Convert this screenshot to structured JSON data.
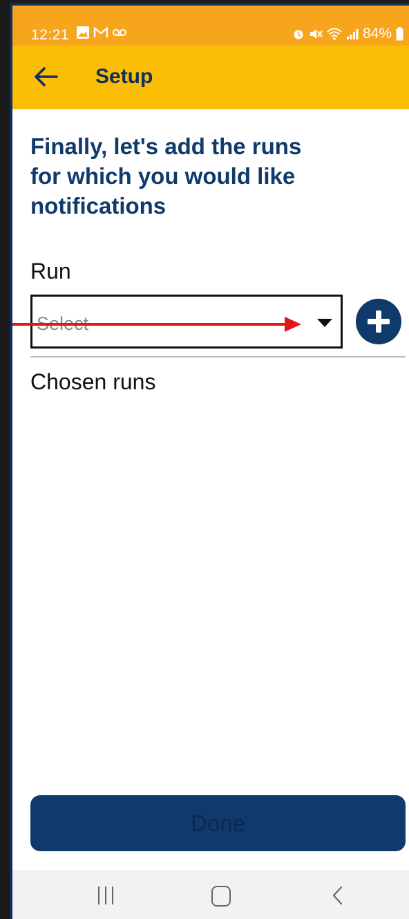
{
  "status_bar": {
    "time": "12:21",
    "battery": "84%",
    "left_icons": [
      "gallery-icon",
      "gmail-icon",
      "voicemail-icon"
    ],
    "right_icons": [
      "alarm-icon",
      "mute-icon",
      "wifi-icon",
      "signal-icon",
      "battery-icon"
    ]
  },
  "app_bar": {
    "title": "Setup",
    "back_icon": "arrow-left-icon"
  },
  "main": {
    "heading": "Finally, let's add the runs for which you would like notifications",
    "run_label": "Run",
    "run_select": {
      "placeholder": "Select",
      "icon": "caret-down-icon"
    },
    "add_button_icon": "plus-icon",
    "chosen_runs_label": "Chosen runs",
    "chosen_runs": []
  },
  "footer": {
    "done_label": "Done"
  },
  "annotation": {
    "arrow_color": "#e8141c"
  },
  "nav_bar": {
    "buttons": [
      "recent-apps-icon",
      "home-icon",
      "back-icon"
    ]
  },
  "colors": {
    "status_bar": "#f8a51e",
    "app_bar": "#fbbe06",
    "primary": "#0f3a6b",
    "frame": "#0f2f5c"
  }
}
